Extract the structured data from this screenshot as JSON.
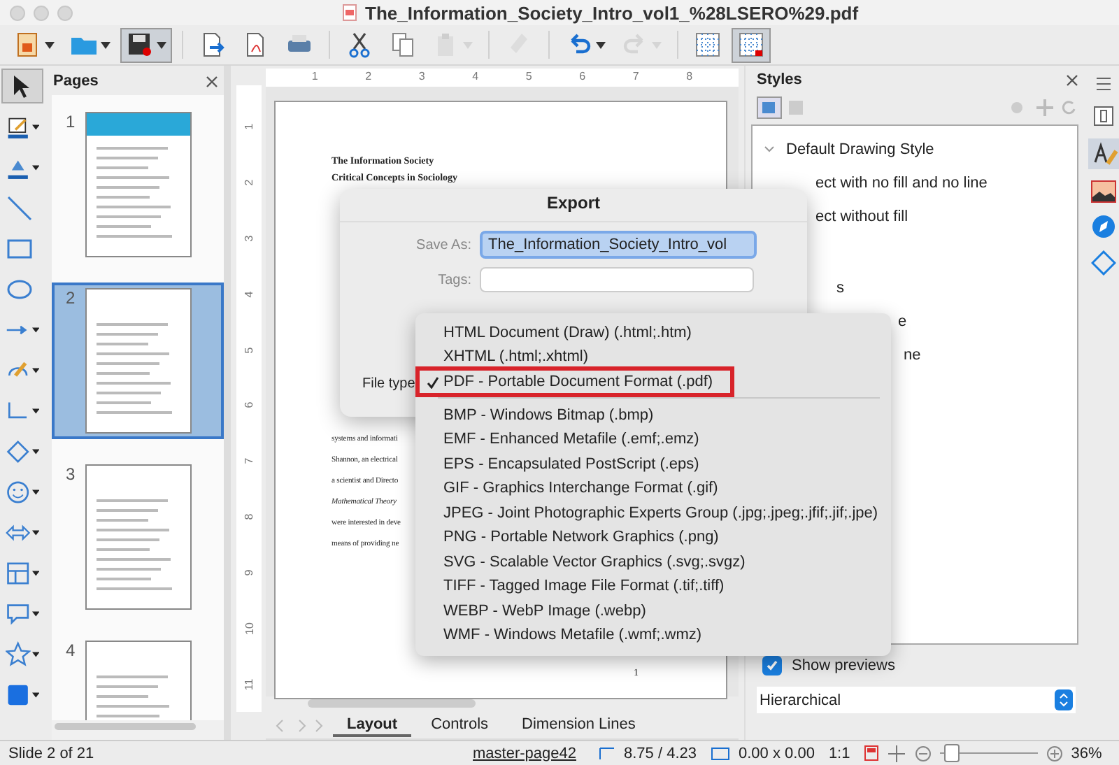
{
  "window": {
    "title": "The_Information_Society_Intro_vol1_%28LSERO%29.pdf"
  },
  "toolbar": [
    {
      "kind": "new",
      "pressed": false,
      "disabled": false
    },
    {
      "kind": "open",
      "pressed": false,
      "disabled": false
    },
    {
      "kind": "save",
      "pressed": true,
      "disabled": false
    },
    {
      "kind": "export",
      "pressed": false,
      "disabled": false
    },
    {
      "kind": "pdf",
      "pressed": false,
      "disabled": false
    },
    {
      "kind": "print",
      "pressed": false,
      "disabled": false
    },
    {
      "kind": "cut",
      "pressed": false,
      "disabled": false
    },
    {
      "kind": "copy",
      "pressed": false,
      "disabled": false
    },
    {
      "kind": "paste",
      "pressed": false,
      "disabled": true
    },
    {
      "kind": "brush",
      "pressed": false,
      "disabled": true
    },
    {
      "kind": "undo",
      "pressed": false,
      "disabled": false
    },
    {
      "kind": "redo",
      "pressed": false,
      "disabled": true
    },
    {
      "kind": "grid",
      "pressed": false,
      "disabled": false
    },
    {
      "kind": "snap",
      "pressed": true,
      "disabled": false
    }
  ],
  "tools": [
    {
      "kind": "pointer",
      "selected": true
    },
    {
      "kind": "line-color",
      "selected": false
    },
    {
      "kind": "fill-color",
      "selected": false
    },
    {
      "kind": "line",
      "selected": false
    },
    {
      "kind": "rect",
      "selected": false
    },
    {
      "kind": "ellipse",
      "selected": false
    },
    {
      "kind": "arrow",
      "selected": false
    },
    {
      "kind": "curve",
      "selected": false
    },
    {
      "kind": "connector",
      "selected": false
    },
    {
      "kind": "diamond",
      "selected": false
    },
    {
      "kind": "smiley",
      "selected": false
    },
    {
      "kind": "double-arrow",
      "selected": false
    },
    {
      "kind": "flowchart",
      "selected": false
    },
    {
      "kind": "callout",
      "selected": false
    },
    {
      "kind": "star",
      "selected": false
    },
    {
      "kind": "cube",
      "selected": false
    }
  ],
  "pages_panel": {
    "title": "Pages",
    "pages": [
      {
        "number": "1",
        "selected": false
      },
      {
        "number": "2",
        "selected": true
      },
      {
        "number": "3",
        "selected": false
      },
      {
        "number": "4",
        "selected": false
      }
    ]
  },
  "rulers": {
    "horizontal": [
      "1",
      "2",
      "3",
      "4",
      "5",
      "6",
      "7",
      "8"
    ],
    "vertical": [
      "1",
      "2",
      "3",
      "4",
      "5",
      "6",
      "7",
      "8",
      "9",
      "10",
      "11"
    ]
  },
  "document": {
    "heading_lines": [
      "The Information Society",
      "Critical Concepts in Sociology"
    ],
    "body_fragments": [
      {
        "text": "systems and informati",
        "italic": false
      },
      {
        "text": "Shannon, an electrical",
        "italic": false
      },
      {
        "text": "a scientist and Directo",
        "italic": false
      },
      {
        "text": "Mathematical Theory",
        "italic": true
      },
      {
        "text": "were interested in deve",
        "italic": false
      },
      {
        "text": "means of providing ne",
        "italic": false
      }
    ],
    "page_number": "1"
  },
  "export_dialog": {
    "title": "Export",
    "save_as_label": "Save As:",
    "save_as_value": "The_Information_Society_Intro_vol",
    "tags_label": "Tags:",
    "file_type_label": "File type"
  },
  "file_type_menu": [
    {
      "kind": "item",
      "label": "HTML Document (Draw) (.html;.htm)",
      "selected": false,
      "highlighted": false
    },
    {
      "kind": "item",
      "label": "XHTML (.html;.xhtml)",
      "selected": false,
      "highlighted": false
    },
    {
      "kind": "item",
      "label": "PDF - Portable Document Format (.pdf)",
      "selected": true,
      "highlighted": true
    },
    {
      "kind": "separator"
    },
    {
      "kind": "item",
      "label": "BMP - Windows Bitmap (.bmp)",
      "selected": false,
      "highlighted": false
    },
    {
      "kind": "item",
      "label": "EMF - Enhanced Metafile (.emf;.emz)",
      "selected": false,
      "highlighted": false
    },
    {
      "kind": "item",
      "label": "EPS - Encapsulated PostScript (.eps)",
      "selected": false,
      "highlighted": false
    },
    {
      "kind": "item",
      "label": "GIF - Graphics Interchange Format (.gif)",
      "selected": false,
      "highlighted": false
    },
    {
      "kind": "item",
      "label": "JPEG - Joint Photographic Experts Group (.jpg;.jpeg;.jfif;.jif;.jpe)",
      "selected": false,
      "highlighted": false
    },
    {
      "kind": "item",
      "label": "PNG - Portable Network Graphics (.png)",
      "selected": false,
      "highlighted": false
    },
    {
      "kind": "item",
      "label": "SVG - Scalable Vector Graphics (.svg;.svgz)",
      "selected": false,
      "highlighted": false
    },
    {
      "kind": "item",
      "label": "TIFF - Tagged Image File Format (.tif;.tiff)",
      "selected": false,
      "highlighted": false
    },
    {
      "kind": "item",
      "label": "WEBP - WebP Image (.webp)",
      "selected": false,
      "highlighted": false
    },
    {
      "kind": "item",
      "label": "WMF - Windows Metafile (.wmf;.wmz)",
      "selected": false,
      "highlighted": false
    }
  ],
  "styles_panel": {
    "title": "Styles",
    "items": [
      {
        "label": "Default Drawing Style",
        "expanded": true
      },
      {
        "label": "ect with no fill and no line",
        "expanded": false
      },
      {
        "label": "ect without fill",
        "expanded": false
      },
      {
        "label": "s",
        "expanded": false
      },
      {
        "label": "e",
        "expanded": false
      },
      {
        "label": "ne",
        "expanded": false
      }
    ],
    "show_previews": {
      "label": "Show previews",
      "checked": true
    },
    "filter": "Hierarchical"
  },
  "bottom_tabs": [
    {
      "label": "Layout",
      "selected": true
    },
    {
      "label": "Controls",
      "selected": false
    },
    {
      "label": "Dimension Lines",
      "selected": false
    }
  ],
  "status_bar": {
    "slide": "Slide 2 of 21",
    "master": "master-page42",
    "position": "8.75 / 4.23",
    "size": "0.00 x 0.00",
    "scale": "1:1",
    "zoom_level": {
      "level": 0.12
    },
    "zoom": "36%"
  }
}
